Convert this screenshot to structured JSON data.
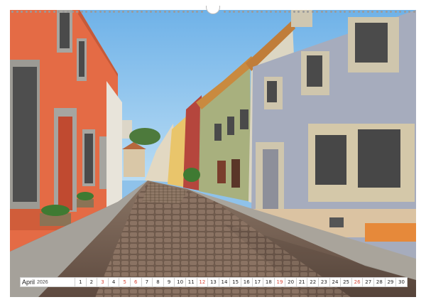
{
  "calendar": {
    "month": "April",
    "year": "2026",
    "days": [
      {
        "n": "1",
        "holiday": false
      },
      {
        "n": "2",
        "holiday": false
      },
      {
        "n": "3",
        "holiday": true
      },
      {
        "n": "4",
        "holiday": false
      },
      {
        "n": "5",
        "holiday": true
      },
      {
        "n": "6",
        "holiday": true
      },
      {
        "n": "7",
        "holiday": false
      },
      {
        "n": "8",
        "holiday": false
      },
      {
        "n": "9",
        "holiday": false
      },
      {
        "n": "10",
        "holiday": false
      },
      {
        "n": "11",
        "holiday": false
      },
      {
        "n": "12",
        "holiday": true
      },
      {
        "n": "13",
        "holiday": false
      },
      {
        "n": "14",
        "holiday": false
      },
      {
        "n": "15",
        "holiday": false
      },
      {
        "n": "16",
        "holiday": false
      },
      {
        "n": "17",
        "holiday": false
      },
      {
        "n": "18",
        "holiday": false
      },
      {
        "n": "19",
        "holiday": true
      },
      {
        "n": "20",
        "holiday": false
      },
      {
        "n": "21",
        "holiday": false
      },
      {
        "n": "22",
        "holiday": false
      },
      {
        "n": "23",
        "holiday": false
      },
      {
        "n": "24",
        "holiday": false
      },
      {
        "n": "25",
        "holiday": false
      },
      {
        "n": "26",
        "holiday": true
      },
      {
        "n": "27",
        "holiday": false
      },
      {
        "n": "28",
        "holiday": false
      },
      {
        "n": "29",
        "holiday": false
      },
      {
        "n": "30",
        "holiday": false
      }
    ]
  },
  "colors": {
    "holiday": "#d84a3a",
    "weekday": "#222222"
  }
}
